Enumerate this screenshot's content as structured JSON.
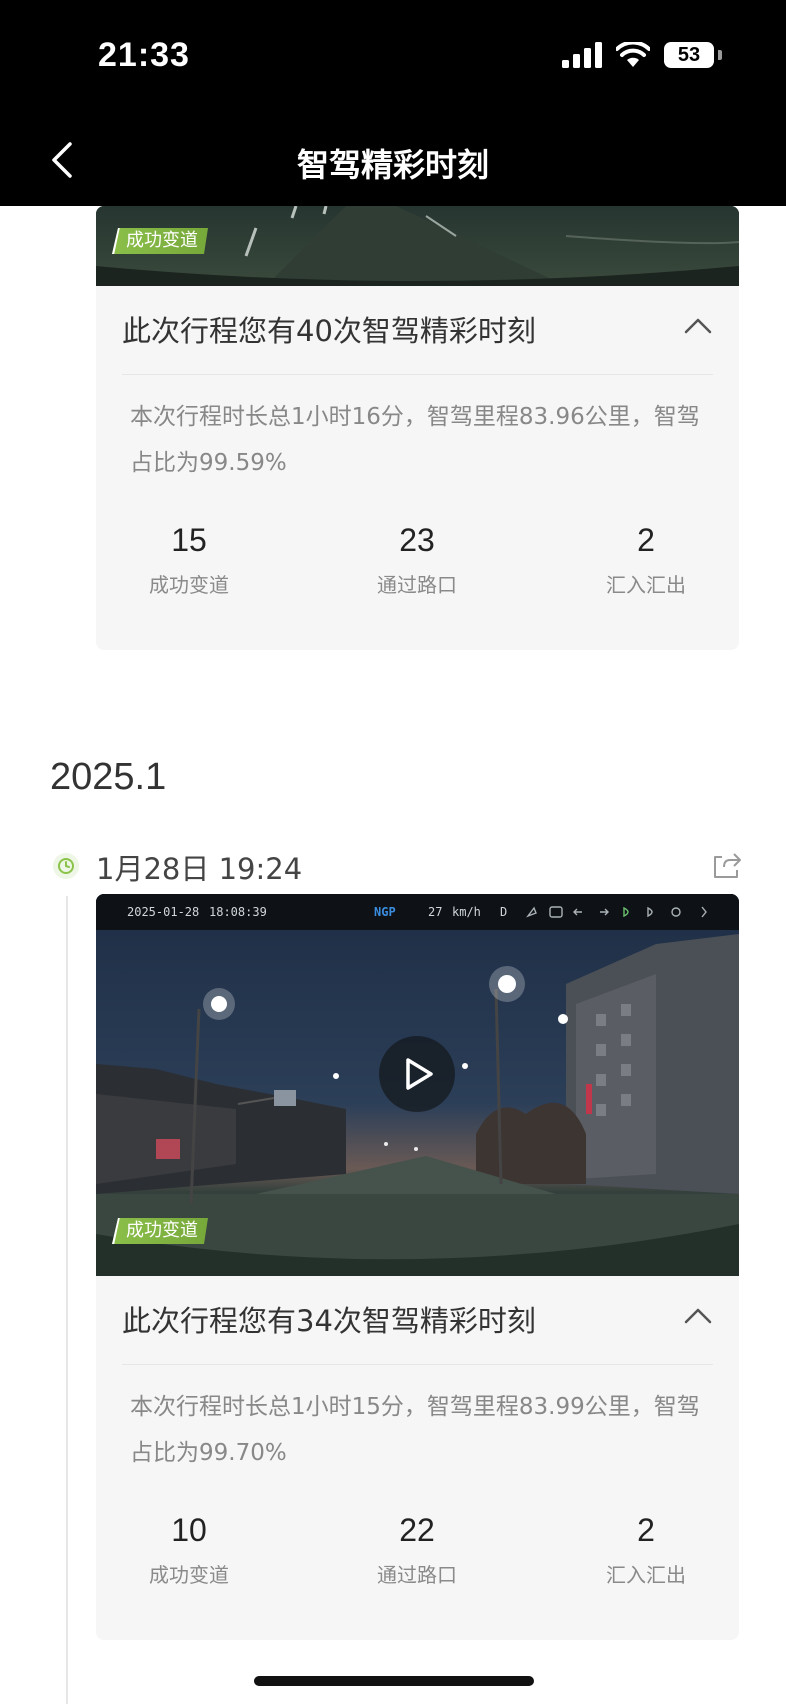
{
  "status": {
    "time": "21:33",
    "battery": "53"
  },
  "nav": {
    "title": "智驾精彩时刻"
  },
  "trips": [
    {
      "tag": "成功变道",
      "title": "此次行程您有40次智驾精彩时刻",
      "summary": "本次行程时长总1小时16分，智驾里程83.96公里，智驾占比为99.59%",
      "stats": [
        {
          "value": "15",
          "label": "成功变道"
        },
        {
          "value": "23",
          "label": "通过路口"
        },
        {
          "value": "2",
          "label": "汇入汇出"
        }
      ]
    },
    {
      "section": "2025.1",
      "date": "1月28日 19:24",
      "osd": {
        "date": "2025-01-28",
        "time": "18:08:39",
        "mode": "NGP",
        "speed": "27",
        "unit": "km/h",
        "gear": "D"
      },
      "tag": "成功变道",
      "title": "此次行程您有34次智驾精彩时刻",
      "summary": "本次行程时长总1小时15分，智驾里程83.99公里，智驾占比为99.70%",
      "stats": [
        {
          "value": "10",
          "label": "成功变道"
        },
        {
          "value": "22",
          "label": "通过路口"
        },
        {
          "value": "2",
          "label": "汇入汇出"
        }
      ]
    }
  ],
  "colors": {
    "tag_green": "#80b543",
    "accent_blue": "#3a8dde",
    "clock_green": "#8bc34a"
  }
}
